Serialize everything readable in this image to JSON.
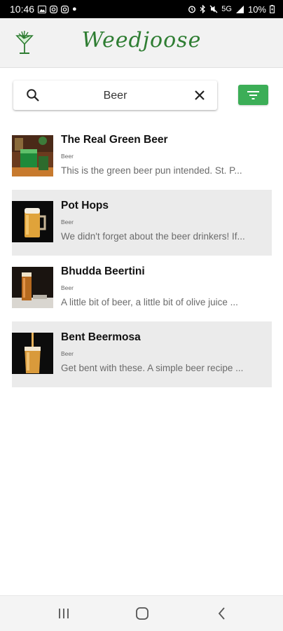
{
  "status_bar": {
    "time": "10:46",
    "left_icons": [
      "image-icon",
      "instagram-icon",
      "instagram-icon",
      "dot-icon"
    ],
    "right_icons": [
      "alarm-icon",
      "bluetooth-icon",
      "mute-icon"
    ],
    "network": "5G",
    "battery": "10%"
  },
  "app": {
    "brand": "Weedjoose",
    "accent_color": "#2e7d32",
    "button_color": "#3cae57"
  },
  "search": {
    "value": "Beer"
  },
  "results": [
    {
      "title": "The Real Green Beer",
      "category": "Beer",
      "description": "This is the green beer pun intended. St. P...",
      "thumbnail": "green-beer-photo"
    },
    {
      "title": "Pot Hops",
      "category": "Beer",
      "description": "We didn't forget about the beer drinkers! If...",
      "thumbnail": "beer-mug-photo"
    },
    {
      "title": "Bhudda Beertini",
      "category": "Beer",
      "description": "A little bit of beer, a little bit of olive juice ...",
      "thumbnail": "beer-glass-photo"
    },
    {
      "title": "Bent Beermosa",
      "category": "Beer",
      "description": "Get bent with these. A simple beer recipe ...",
      "thumbnail": "beer-pour-photo"
    }
  ],
  "nav": {
    "icons": [
      "recent-apps-icon",
      "home-icon",
      "back-icon"
    ]
  }
}
